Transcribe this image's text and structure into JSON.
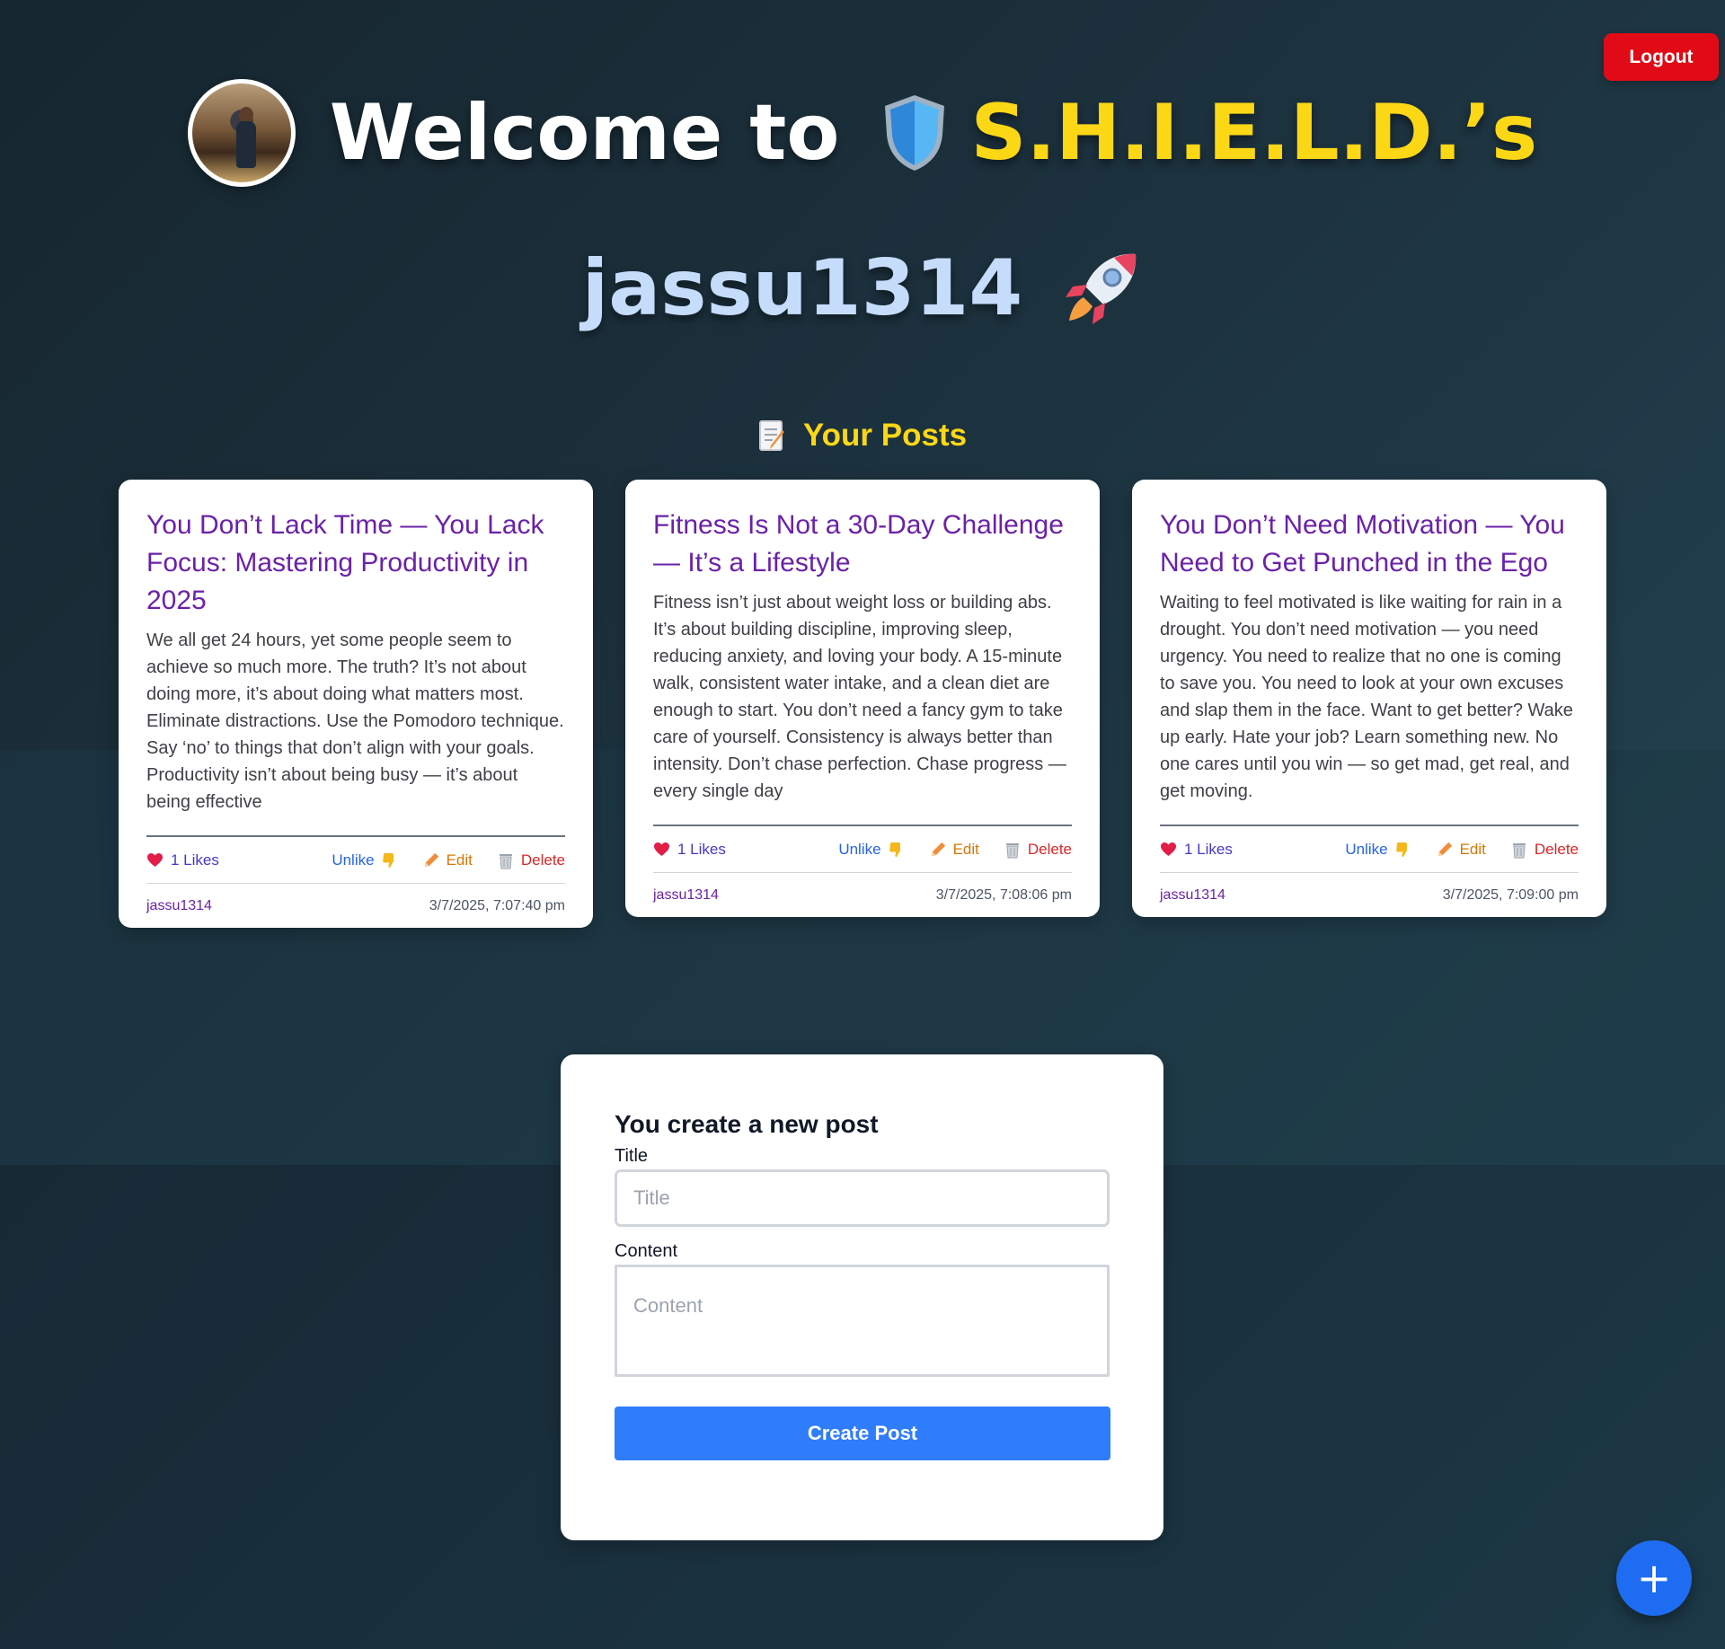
{
  "header": {
    "logout_label": "Logout",
    "welcome_text": "Welcome to",
    "brand_text": "S.H.I.E.L.D.’s",
    "username": "jassu1314"
  },
  "posts_section": {
    "title": "Your Posts"
  },
  "posts": [
    {
      "title": "You Don’t Lack Time — You Lack Focus: Mastering Productivity in 2025",
      "content": "We all get 24 hours, yet some people seem to achieve so much more. The truth? It’s not about doing more, it’s about doing what matters most. Eliminate distractions. Use the Pomodoro technique. Say ‘no’ to things that don’t align with your goals. Productivity isn’t about being busy — it’s about being effective",
      "likes": "1 Likes",
      "unlike_label": "Unlike",
      "edit_label": "Edit",
      "delete_label": "Delete",
      "author": "jassu1314",
      "timestamp": "3/7/2025, 7:07:40 pm"
    },
    {
      "title": "Fitness Is Not a 30-Day Challenge — It’s a Lifestyle",
      "content": "Fitness isn’t just about weight loss or building abs. It’s about building discipline, improving sleep, reducing anxiety, and loving your body. A 15-minute walk, consistent water intake, and a clean diet are enough to start. You don’t need a fancy gym to take care of yourself. Consistency is always better than intensity. Don’t chase perfection. Chase progress — every single day",
      "likes": "1 Likes",
      "unlike_label": "Unlike",
      "edit_label": "Edit",
      "delete_label": "Delete",
      "author": "jassu1314",
      "timestamp": "3/7/2025, 7:08:06 pm"
    },
    {
      "title": "You Don’t Need Motivation — You Need to Get Punched in the Ego",
      "content": "Waiting to feel motivated is like waiting for rain in a drought. You don’t need motivation — you need urgency. You need to realize that no one is coming to save you. You need to look at your own excuses and slap them in the face. Want to get better? Wake up early. Hate your job? Learn something new. No one cares until you win — so get mad, get real, and get moving.",
      "likes": "1 Likes",
      "unlike_label": "Unlike",
      "edit_label": "Edit",
      "delete_label": "Delete",
      "author": "jassu1314",
      "timestamp": "3/7/2025, 7:09:00 pm"
    }
  ],
  "create_form": {
    "heading": "You create a new post",
    "title_label": "Title",
    "title_placeholder": "Title",
    "title_value": "",
    "content_label": "Content",
    "content_placeholder": "Content",
    "content_value": "",
    "submit_label": "Create Post"
  },
  "fab": {
    "label": "+"
  },
  "colors": {
    "brand_yellow": "#fcd716",
    "username_blue": "#c6dcfb",
    "logout_red": "#e00b16",
    "post_title_purple": "#6b21a8",
    "primary_blue": "#2f7dfa"
  },
  "icons": [
    "avatar",
    "shield-icon",
    "rocket-icon",
    "memo-icon",
    "heart-icon",
    "thumbs-down-icon",
    "pencil-icon",
    "trash-icon",
    "plus-icon"
  ]
}
